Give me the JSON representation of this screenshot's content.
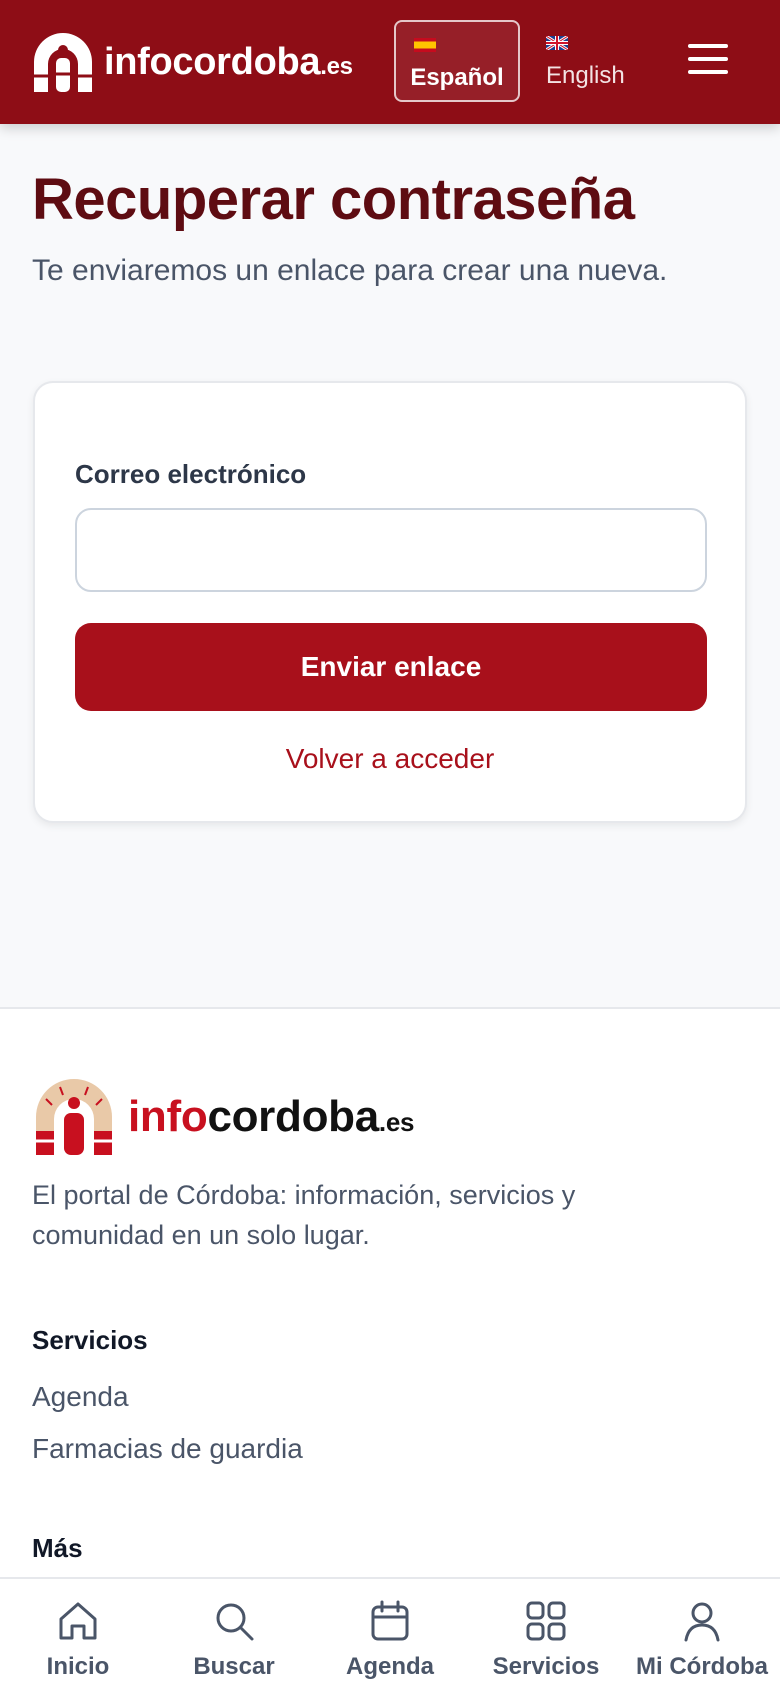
{
  "header": {
    "logo_name": "infocordoba",
    "logo_tld": ".es",
    "languages": [
      {
        "label": "Español",
        "flag": "es-flag-icon",
        "active": true
      },
      {
        "label": "English",
        "flag": "uk-flag-icon",
        "active": false
      }
    ]
  },
  "main": {
    "title": "Recuperar contraseña",
    "subtitle": "Te enviaremos un enlace para crear una nueva.",
    "form": {
      "email_label": "Correo electrónico",
      "email_value": "",
      "email_placeholder": "",
      "submit_label": "Enviar enlace",
      "back_link": "Volver a acceder"
    }
  },
  "footer": {
    "logo_part1": "info",
    "logo_part2": "cordoba",
    "logo_tld": ".es",
    "tagline": "El portal de Córdoba: información, servicios y comunidad en un solo lugar.",
    "sections": [
      {
        "heading": "Servicios",
        "links": [
          "Agenda",
          "Farmacias de guardia"
        ]
      },
      {
        "heading": "Más",
        "links": []
      }
    ]
  },
  "bottom_nav": [
    {
      "label": "Inicio",
      "icon": "home-icon"
    },
    {
      "label": "Buscar",
      "icon": "search-icon"
    },
    {
      "label": "Agenda",
      "icon": "calendar-icon"
    },
    {
      "label": "Servicios",
      "icon": "grid-icon"
    },
    {
      "label": "Mi Córdoba",
      "icon": "user-icon"
    }
  ],
  "colors": {
    "brand": "#8e0d16",
    "accent": "#a8101b",
    "title": "#5e0c12"
  }
}
